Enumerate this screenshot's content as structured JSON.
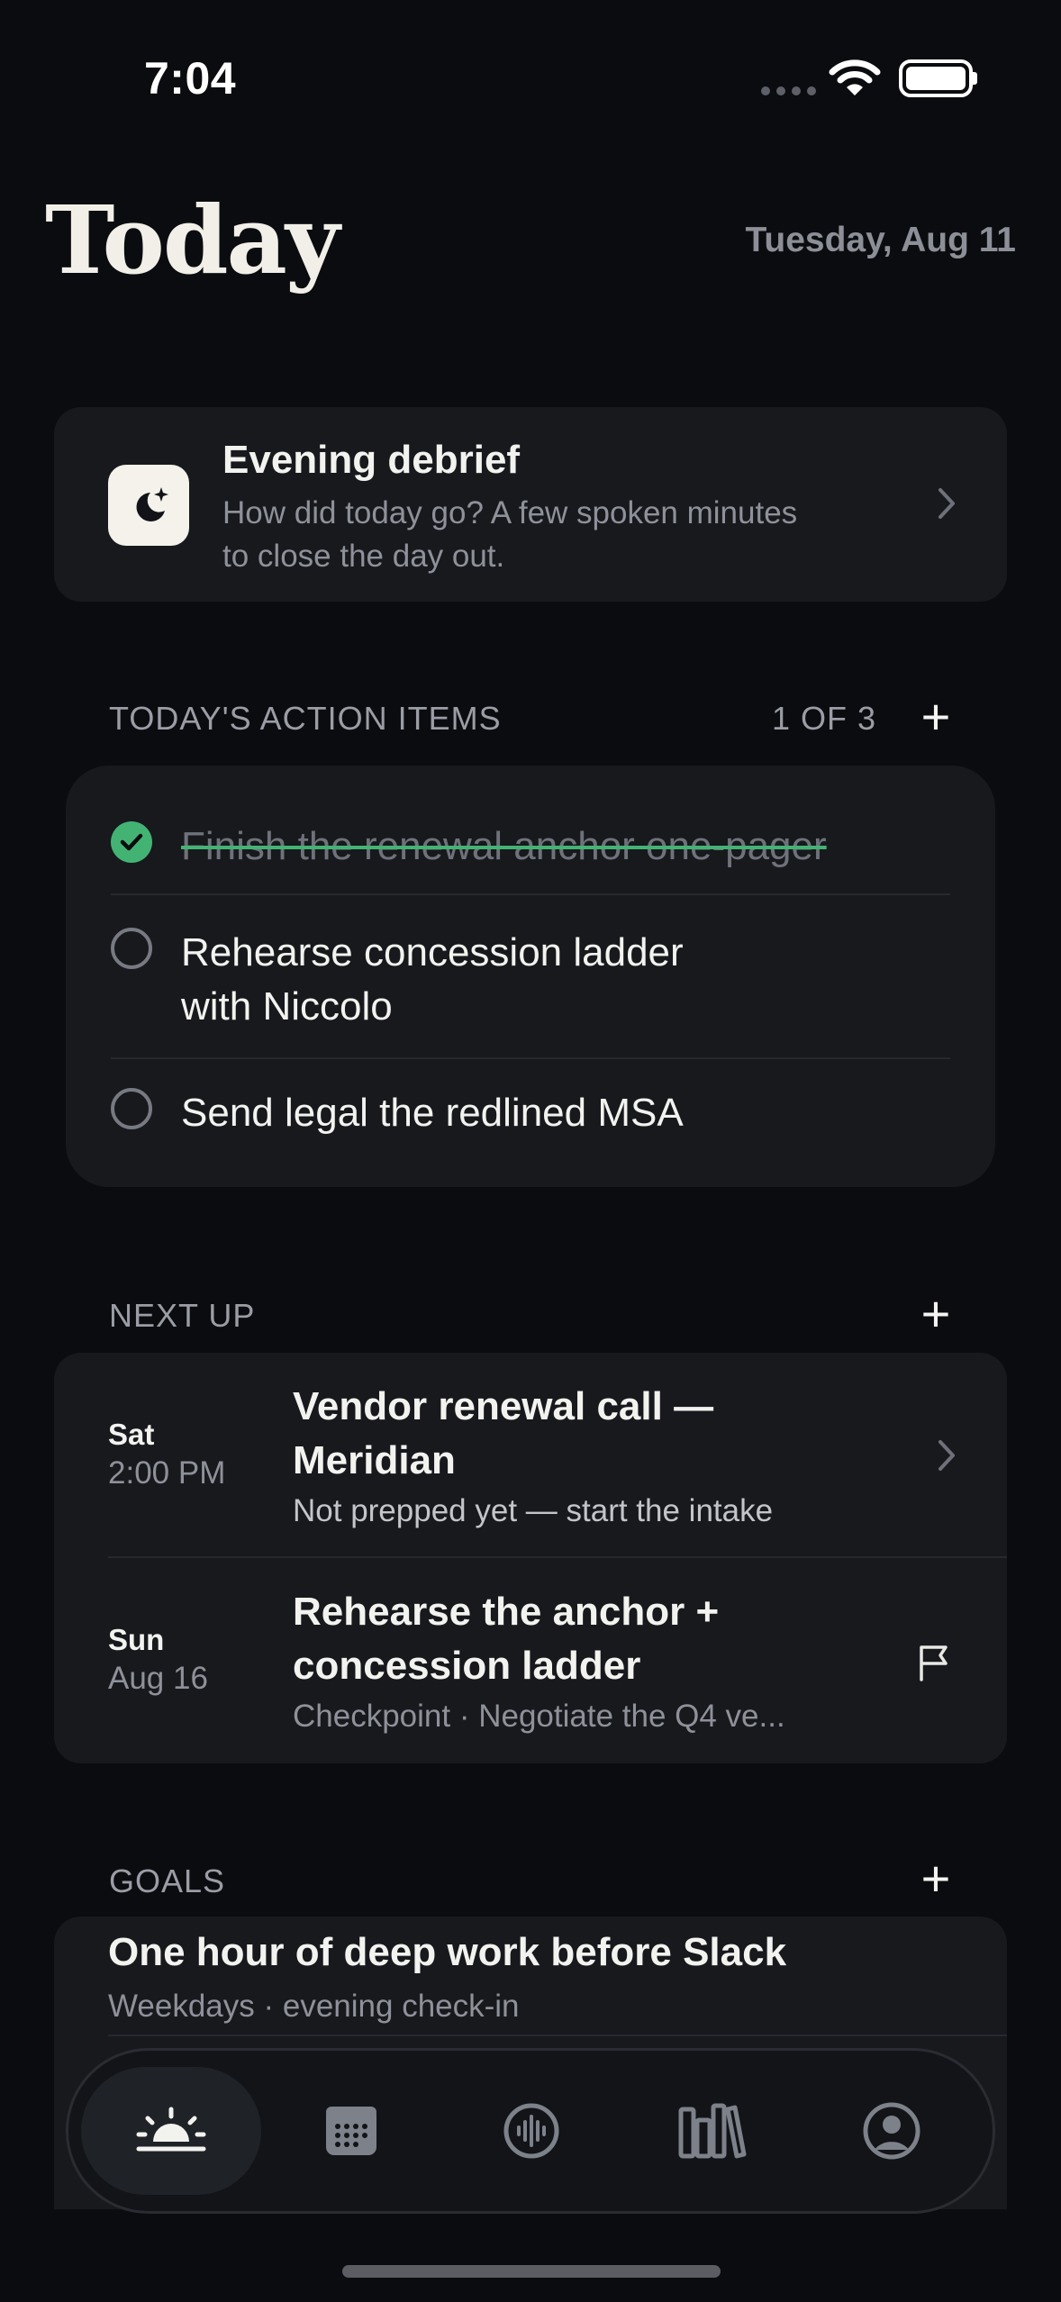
{
  "status_bar": {
    "time": "7:04"
  },
  "header": {
    "title": "Today",
    "date": "Tuesday, Aug 11"
  },
  "debrief": {
    "title": "Evening debrief",
    "subtitle": "How did today go? A few spoken minutes to close the day out.",
    "icon": "moon-sparkle-icon"
  },
  "action_items": {
    "label": "TODAY'S ACTION ITEMS",
    "count": "1 OF 3",
    "items": [
      {
        "text": "Finish the renewal anchor one-pager",
        "done": true
      },
      {
        "text": "Rehearse concession ladder with Niccolo",
        "done": false
      },
      {
        "text": "Send legal the redlined MSA",
        "done": false
      }
    ]
  },
  "next_up": {
    "label": "NEXT UP",
    "items": [
      {
        "day": "Sat",
        "time": "2:00 PM",
        "title": "Vendor renewal call — Meridian",
        "subtitle": "Not prepped yet — start the intake",
        "icon": "chevron-right-icon"
      },
      {
        "day": "Sun",
        "time": "Aug 16",
        "title": "Rehearse the anchor + concession ladder",
        "subtitle": "Checkpoint · Negotiate the Q4 ve...",
        "icon": "flag-icon"
      }
    ]
  },
  "goals": {
    "label": "GOALS",
    "items": [
      {
        "title": "One hour of deep work before Slack",
        "subtitle": "Weekdays · evening check-in"
      }
    ]
  },
  "tab_bar": {
    "tabs": [
      {
        "name": "today",
        "icon": "sunrise-icon",
        "active": true
      },
      {
        "name": "calendar",
        "icon": "calendar-icon",
        "active": false
      },
      {
        "name": "voice",
        "icon": "waveform-icon",
        "active": false
      },
      {
        "name": "library",
        "icon": "books-icon",
        "active": false
      },
      {
        "name": "profile",
        "icon": "person-circle-icon",
        "active": false
      }
    ]
  },
  "colors": {
    "background": "#0b0c0f",
    "card": "#17191d",
    "accent_green": "#43b373"
  }
}
